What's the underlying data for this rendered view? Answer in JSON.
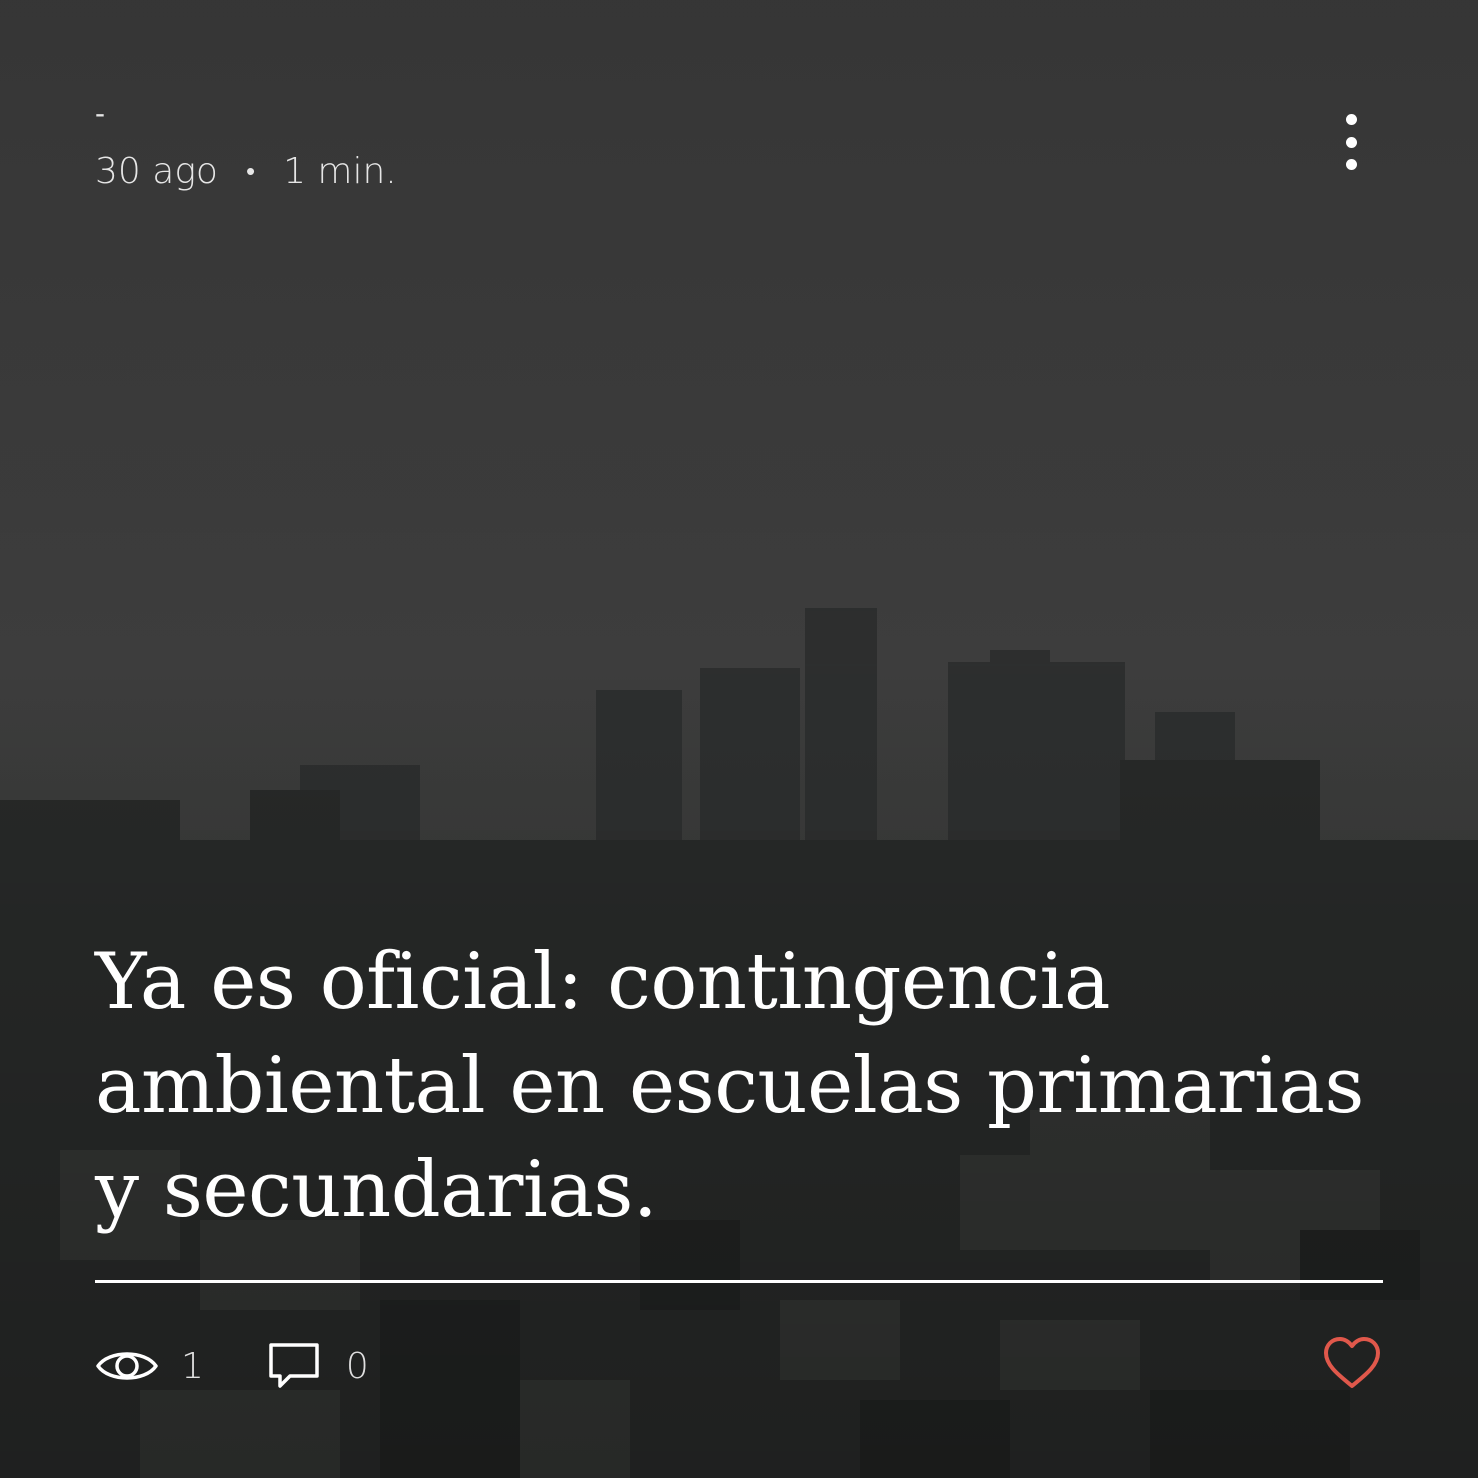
{
  "post": {
    "author": "-",
    "date": "30 ago",
    "separator": "•",
    "read_time": "1 min.",
    "title": "Ya es oficial: contingencia ambiental en escuelas primarias y secundarias.",
    "views": "1",
    "comments": "0"
  },
  "icons": {
    "more": "more-options-icon",
    "views": "eye-icon",
    "comments": "comment-bubble-icon",
    "like": "heart-icon"
  },
  "colors": {
    "text": "#ffffff",
    "like": "#e0584b"
  }
}
